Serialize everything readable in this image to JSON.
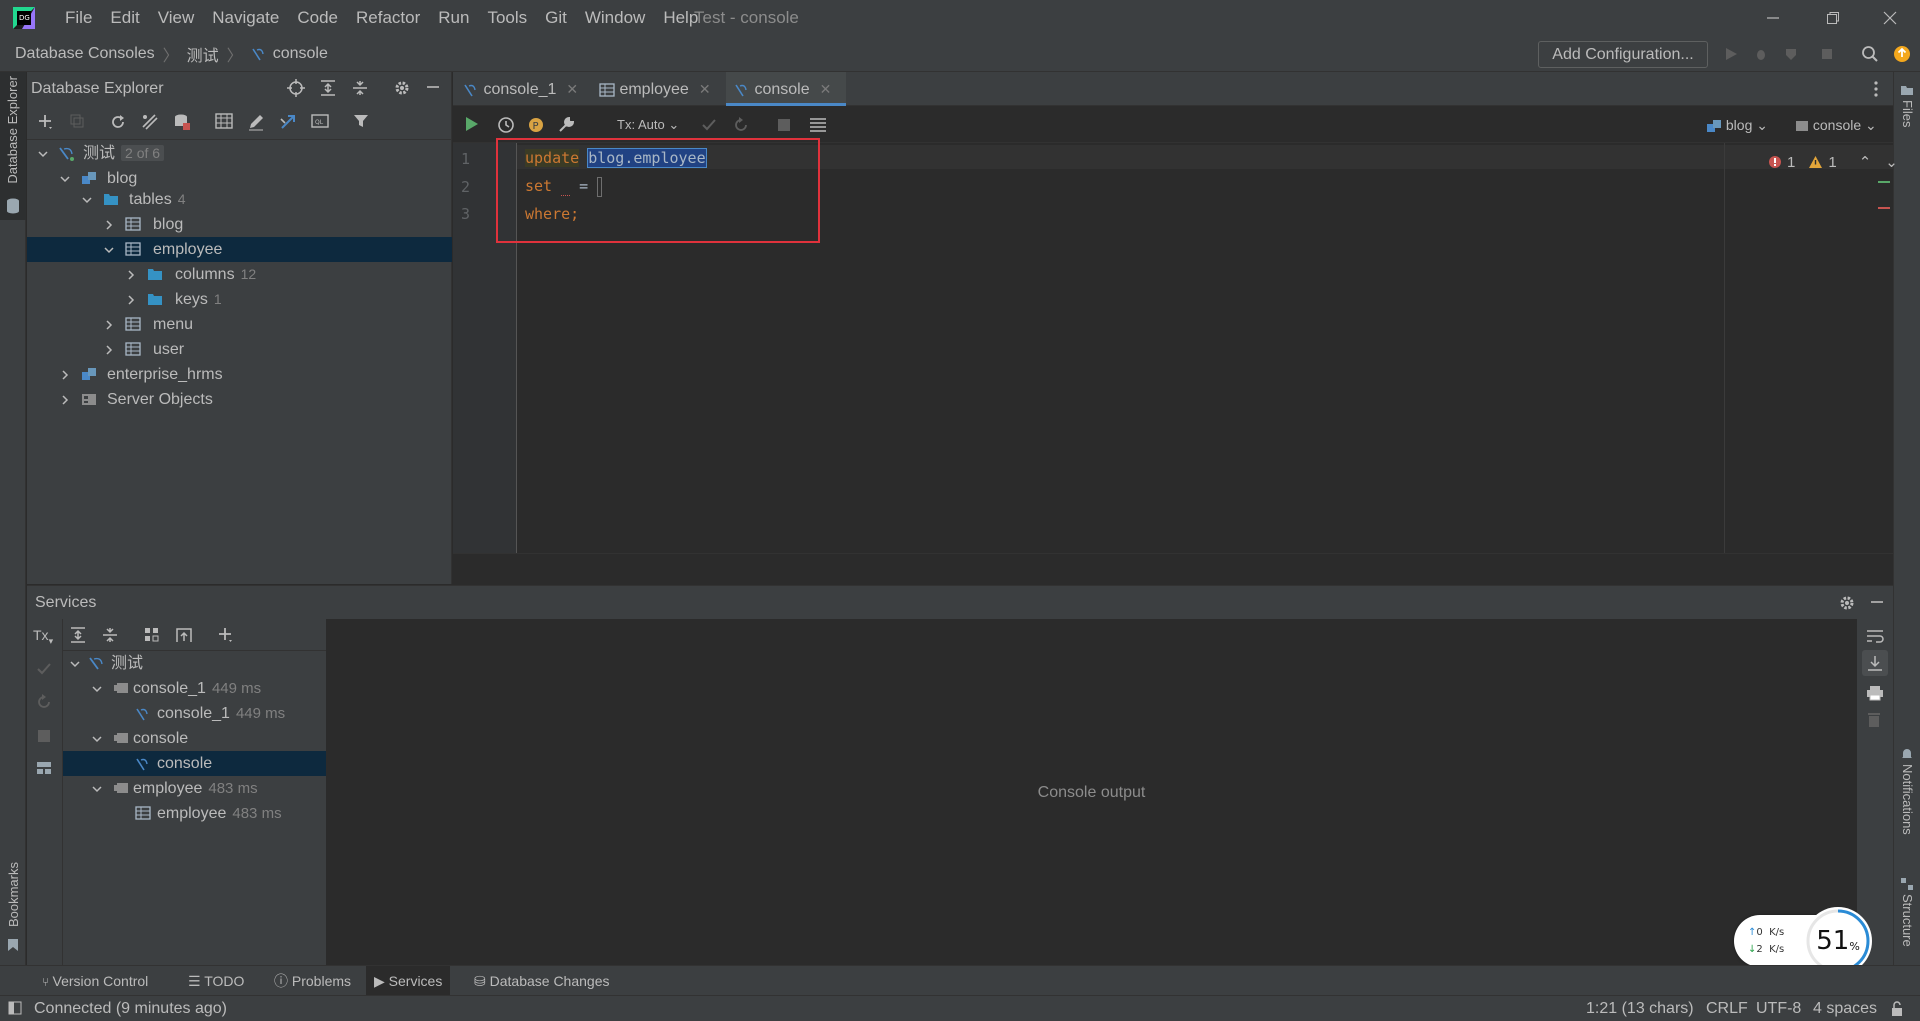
{
  "window": {
    "title": "Test - console",
    "menu": [
      "File",
      "Edit",
      "View",
      "Navigate",
      "Code",
      "Refactor",
      "Run",
      "Tools",
      "Git",
      "Window",
      "Help"
    ]
  },
  "breadcrumb": [
    "Database Consoles",
    "测试",
    "console"
  ],
  "navbar": {
    "add_config_label": "Add Configuration..."
  },
  "left_stripe": {
    "db_explorer_label": "Database Explorer",
    "bookmarks_label": "Bookmarks"
  },
  "right_stripe": {
    "files_label": "Files",
    "notifications_label": "Notifications",
    "structure_label": "Structure"
  },
  "db_explorer": {
    "title": "Database Explorer",
    "tree": {
      "root": {
        "label": "测试",
        "badge": "2 of 6"
      },
      "blog": "blog",
      "tables": {
        "label": "tables",
        "count": "4"
      },
      "t_blog": "blog",
      "t_employee": "employee",
      "columns": {
        "label": "columns",
        "count": "12"
      },
      "keys": {
        "label": "keys",
        "count": "1"
      },
      "t_menu": "menu",
      "t_user": "user",
      "enterprise": "enterprise_hrms",
      "server_objects": "Server Objects"
    }
  },
  "editor": {
    "tabs": [
      {
        "label": "console_1"
      },
      {
        "label": "employee"
      },
      {
        "label": "console"
      }
    ],
    "tx_mode": "Tx: Auto",
    "schema": "blog",
    "session": "console",
    "errors": "1",
    "warnings": "1",
    "line_numbers": [
      "1",
      "2",
      "3"
    ],
    "code": {
      "line1_kw": "update",
      "line1_ident": "blog.employee",
      "line2_kw": "set",
      "line2_eq": " =",
      "line3_kw": "where;"
    }
  },
  "services": {
    "title": "Services",
    "tree": {
      "root": "测试",
      "console_1_group": {
        "label": "console_1",
        "time": "449 ms"
      },
      "console_1_item": {
        "label": "console_1",
        "time": "449 ms"
      },
      "console_group": {
        "label": "console"
      },
      "console_item": {
        "label": "console"
      },
      "employee_group": {
        "label": "employee",
        "time": "483 ms"
      },
      "employee_item": {
        "label": "employee",
        "time": "483 ms"
      }
    },
    "console_output": "Console output",
    "tx_label": "Tx"
  },
  "net_widget": {
    "up_value": "0",
    "down_value": "2",
    "unit": "K/s",
    "percent": "51",
    "percent_sign": "%"
  },
  "tool_tabs": [
    "Version Control",
    "TODO",
    "Problems",
    "Services",
    "Database Changes"
  ],
  "status": {
    "connection": "Connected (9 minutes ago)",
    "position": "1:21 (13 chars)",
    "line_sep": "CRLF",
    "encoding": "UTF-8",
    "indent": "4 spaces"
  },
  "colors": {
    "accent": "#4a88c7",
    "keyword": "#cc7832",
    "selection": "#0d293e",
    "highlight_box": "#e0323c"
  }
}
